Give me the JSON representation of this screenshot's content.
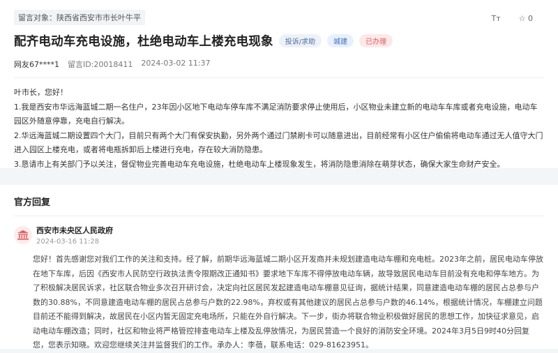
{
  "message": {
    "recipient": "留言对象：陕西省西安市市长叶牛平",
    "title": "配齐电动车充电设施，杜绝电动车上楼充电现象",
    "tags": [
      "投诉/求助",
      "城建",
      "已办理"
    ],
    "user": "网友67****1",
    "id": "留言ID:20018411",
    "time": "2024-03-02 11:37",
    "font_toggle": "Tт",
    "like_count": "0",
    "paragraphs": [
      "叶市长，您好！",
      "1.我是西安市华远海蓝城二期一名住户，23年因小区地下电动车停车库不满足消防要求停止使用后，小区物业未建立新的电动车车库或者充电设施，电动车园区外随意停靠，充电自行解决。",
      "2.华远海蓝城二期设置四个大门，目前只有两个大门有保安执勤，另外两个通过门禁刷卡可以随意进出，目前经常有小区住户偷偷将电动车通过无人值守大门进入园区上楼充电，或者将电瓶拆卸后上楼进行充电，存在较大消防隐患。",
      "3.恳请市上有关部门予以关注，督促物业完善电动车充电设施，杜绝电动车上楼现象发生，将消防隐患消除在萌芽状态，确保大家生命财产安全。"
    ]
  },
  "reply": {
    "section_title": "官方回复",
    "org_name": "西安市未央区人民政府",
    "org_time": "2024-03-16 11:28",
    "text": "您好！首先感谢您对我们工作的关注和支持。经了解，前期华远海蓝城二期小区开发商并未规划建造电动车棚和充电桩。2023年之前，居民电动车停放在地下车库，后因《西安市人民防空行政执法责令限期改正通知书》要求地下车库不得停放电动车辆，故导致居民电动车目前没有充电和停车地方。为了积极解决居民诉求，社区联合物业多次召开研讨会，决定向社区居民发起建造电动车棚意见征询，据统计结果，同意建造电动车棚的居民占总参与户数的30.88%，不同意建造电动车棚的居民占总参与户数的22.98%，弃权或有其他建议的居民占总参与户数的46.14%，根据统计情况，车棚建立问题目前还不能得到解决，故居民在小区内暂无固定充电场所，只能在外自行解决。下一步，街办将联合物业积极做好居民的思想工作，加快征求意见，启动电动车棚改造；同时，社区和物业将严格管控排查电动车上楼及乱停放情况，为居民营造一个良好的消防安全环境。2024年3月5日9时40分回复您，您表示知晓。欢迎您继续关注并监督我们的工作。承办人：李蓓，联系电话：029-81623951。"
  },
  "colors": {
    "accent_red": "#e05b5b",
    "tag_blue": "#3f6fc4"
  },
  "icons": {
    "like": "star-icon",
    "font": "font-size-icon",
    "org": "government-building-icon"
  }
}
